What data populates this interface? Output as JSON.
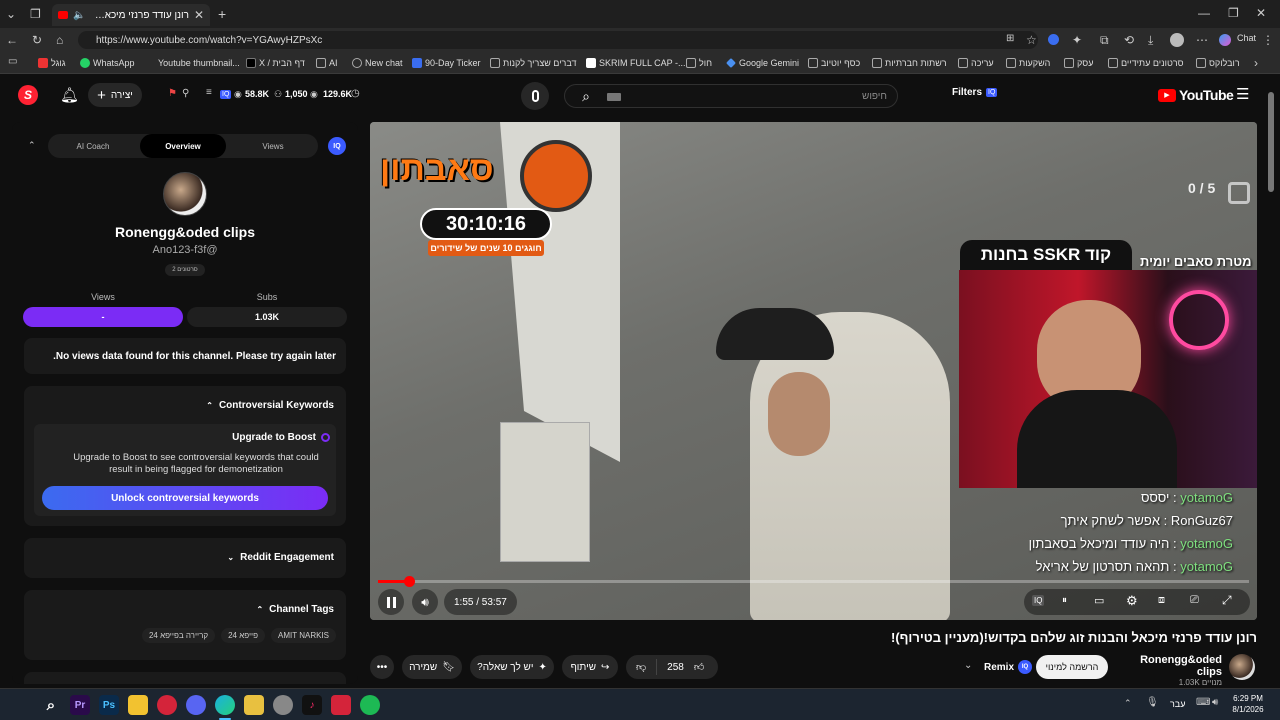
{
  "browser": {
    "tab_title": "רונן עודד פרנזי מיכאל והבנות זוג שלהם בקדוש!",
    "url": "https://www.youtube.com/watch?v=YGAwyHZPsXc",
    "chat_label": "Chat",
    "bookmarks": [
      "גוגל",
      "WhatsApp",
      "Youtube thumbnail...",
      "X / דף הבית",
      "AI",
      "New chat",
      "90-Day Ticker",
      "דברים שצריך לקנות",
      "SKRIM FULL CAP -...",
      "חול",
      "Google Gemini",
      "כסף יוטיוב",
      "רשתות חברתיות",
      "עריכה",
      "השקעות",
      "עסק",
      "סרטונים עתידיים",
      "רובלוקס"
    ]
  },
  "youtube": {
    "logo": "YouTube",
    "create_label": "יצירה",
    "stats": {
      "views": "58.8K",
      "subs": "1,050",
      "watch": "129.6K"
    },
    "search_placeholder": "חיפוש",
    "filters_label": "Filters",
    "iq_badge": "IQ"
  },
  "panel": {
    "tabs": [
      "AI Coach",
      "Overview",
      "Views"
    ],
    "active_tab": "Overview",
    "channel_name": "Ronengg&oded clips",
    "channel_handle": "Ano123-f3f@",
    "videos_badge": "2 סרטונים",
    "views_label": "Views",
    "subs_label": "Subs",
    "views_value": "-",
    "subs_value": "1.03K",
    "no_data": ".No views data found for this channel. Please try again later",
    "controversial_title": "Controversial Keywords",
    "upgrade_title": "Upgrade to Boost",
    "upgrade_text": "Upgrade to Boost to see controversial keywords that could result in being flagged for demonetization",
    "unlock_button": "Unlock controversial keywords",
    "reddit_title": "Reddit Engagement",
    "tags_title": "Channel Tags",
    "tags": [
      "AMIT NARKIS",
      "פייפא 24",
      "קריירה בפייפא 24"
    ]
  },
  "video": {
    "timer_title": "סאבתון",
    "timer_value": "30:10:16",
    "timer_sub": "חוגגים 10 שנים של שידורים",
    "goal_count": "0 / 5",
    "goal_label": "מטרת סאבים יומית",
    "code_banner": "קוד SSKR בחנות",
    "chat": [
      {
        "user": "yotamoG",
        "msg": "יססס",
        "color": "#7fe07f"
      },
      {
        "user": "RonGuz67",
        "msg": "אפשר לשחק איתך",
        "color": "#ffffff"
      },
      {
        "user": "yotamoG",
        "msg": "היה עודד ומיכאל בסאבתון",
        "color": "#7fe07f"
      },
      {
        "user": "yotamoG",
        "msg": "תהאה תסרטון של אריאל",
        "color": "#7fe07f"
      }
    ],
    "time_display": "1:55 / 53:57",
    "progress": 0.036,
    "title": "רונן עודד פרנזי מיכאל והבנות זוג שלהם בקדוש!(מעניין בטירוף)!"
  },
  "actions": {
    "like_count": "258",
    "share_label": "שיתוף",
    "ask_label": "יש לך שאלה?",
    "save_label": "שמירה",
    "remix_label": "Remix",
    "subscribe_label": "הרשמה למינוי",
    "channel_name": "Ronengg&oded clips",
    "channel_subs": "1.03K מנויים"
  },
  "taskbar": {
    "lang": "עבר",
    "time": "6:29 PM",
    "date": "8/1/2026"
  },
  "colors": {
    "accent_purple": "#7b2cf5",
    "youtube_red": "#ff0000",
    "blue_button": "#3b5bff"
  }
}
